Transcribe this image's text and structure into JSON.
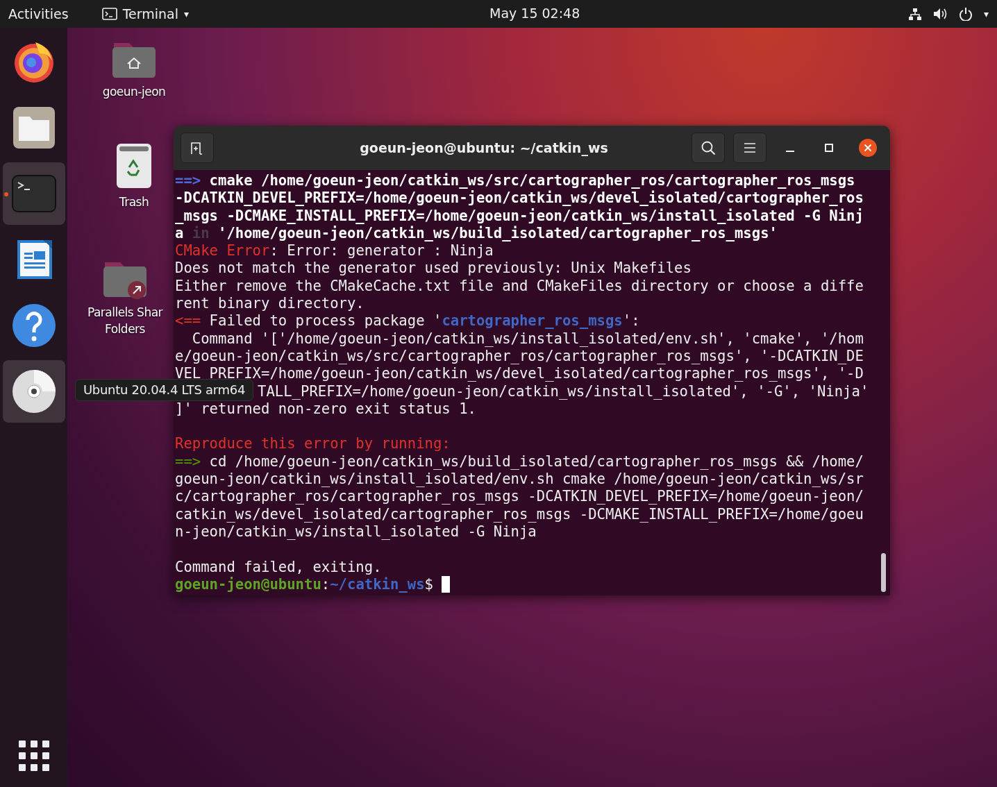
{
  "top_bar": {
    "activities": "Activities",
    "app_menu": {
      "label": "Terminal",
      "caret": "▾"
    },
    "clock": "May 15  02:48",
    "status_caret": "▾"
  },
  "dock": {
    "items": [
      {
        "kind": "browser",
        "running": false,
        "highlighted": false
      },
      {
        "kind": "files",
        "running": false,
        "highlighted": false
      },
      {
        "kind": "terminal",
        "running": true,
        "highlighted": true
      },
      {
        "kind": "writer",
        "running": false,
        "highlighted": false
      },
      {
        "kind": "help",
        "running": false,
        "highlighted": false
      },
      {
        "kind": "disc",
        "running": false,
        "highlighted": true
      }
    ]
  },
  "tooltip": "Ubuntu 20.04.4 LTS arm64",
  "desktop_icons": [
    {
      "kind": "home",
      "label_lines": [
        "goeun-jeon"
      ]
    },
    {
      "kind": "trash",
      "label_lines": [
        "Trash"
      ]
    },
    {
      "kind": "shared",
      "label_lines": [
        "Parallels Shar",
        "Folders"
      ]
    }
  ],
  "terminal": {
    "title": "goeun-jeon@ubuntu: ~/catkin_ws",
    "lines": [
      {
        "kind": "text",
        "segments": [
          {
            "kind": "start_marker",
            "text": "==>"
          },
          {
            "kind": "command",
            "text": " cmake /home/goeun-jeon/catkin_ws/src/cartographer_ros/cartographer_ros_msgs"
          }
        ]
      },
      {
        "kind": "text",
        "segments": [
          {
            "kind": "command",
            "text": "-DCATKIN_DEVEL_PREFIX=/home/goeun-jeon/catkin_ws/devel_isolated/cartographer_ros"
          }
        ]
      },
      {
        "kind": "text",
        "segments": [
          {
            "kind": "command",
            "text": "_msgs -DCMAKE_INSTALL_PREFIX=/home/goeun-jeon/catkin_ws/install_isolated -G Ninj"
          }
        ]
      },
      {
        "kind": "text",
        "segments": [
          {
            "kind": "command",
            "text": "a "
          },
          {
            "kind": "faint_word",
            "text": "in"
          },
          {
            "kind": "command",
            "text": " '/home/goeun-jeon/catkin_ws/build_isolated/cartographer_ros_msgs'"
          }
        ]
      },
      {
        "kind": "text",
        "segments": [
          {
            "kind": "error_label",
            "text": "CMake Error"
          },
          {
            "kind": "output",
            "text": ": Error: generator : Ninja"
          }
        ]
      },
      {
        "kind": "text",
        "segments": [
          {
            "kind": "output",
            "text": "Does not match the generator used previously: Unix Makefiles"
          }
        ]
      },
      {
        "kind": "text",
        "segments": [
          {
            "kind": "output",
            "text": "Either remove the CMakeCache.txt file and CMakeFiles directory or choose a diffe"
          }
        ]
      },
      {
        "kind": "text",
        "segments": [
          {
            "kind": "output",
            "text": "rent binary directory."
          }
        ]
      },
      {
        "kind": "text",
        "segments": [
          {
            "kind": "failure_marker",
            "text": "<=="
          },
          {
            "kind": "output",
            "text": " Failed to process package '"
          },
          {
            "kind": "package_name",
            "text": "cartographer_ros_msgs"
          },
          {
            "kind": "output",
            "text": "':"
          }
        ]
      },
      {
        "kind": "text",
        "segments": [
          {
            "kind": "output",
            "text": "  Command '['/home/goeun-jeon/catkin_ws/install_isolated/env.sh', 'cmake', '/hom"
          }
        ]
      },
      {
        "kind": "text",
        "segments": [
          {
            "kind": "output",
            "text": "e/goeun-jeon/catkin_ws/src/cartographer_ros/cartographer_ros_msgs', '-DCATKIN_DE"
          }
        ]
      },
      {
        "kind": "text",
        "segments": [
          {
            "kind": "output",
            "text": "VEL_PREFIX=/home/goeun-jeon/catkin_ws/devel_isolated/cartographer_ros_msgs', '-D"
          }
        ]
      },
      {
        "kind": "covered",
        "segments": [
          {
            "kind": "output",
            "text": "TALL_PREFIX=/home/goeun-jeon/catkin_ws/install_isolated', '-G', 'Ninja'"
          }
        ]
      },
      {
        "kind": "text",
        "segments": [
          {
            "kind": "output",
            "text": "]' returned non-zero exit status 1."
          }
        ]
      },
      {
        "kind": "blank"
      },
      {
        "kind": "text",
        "segments": [
          {
            "kind": "error_label",
            "text": "Reproduce this error by running:"
          }
        ]
      },
      {
        "kind": "text",
        "segments": [
          {
            "kind": "reproduce_marker",
            "text": "==>"
          },
          {
            "kind": "output",
            "text": " cd /home/goeun-jeon/catkin_ws/build_isolated/cartographer_ros_msgs && /home/"
          }
        ]
      },
      {
        "kind": "text",
        "segments": [
          {
            "kind": "output",
            "text": "goeun-jeon/catkin_ws/install_isolated/env.sh cmake /home/goeun-jeon/catkin_ws/sr"
          }
        ]
      },
      {
        "kind": "text",
        "segments": [
          {
            "kind": "output",
            "text": "c/cartographer_ros/cartographer_ros_msgs -DCATKIN_DEVEL_PREFIX=/home/goeun-jeon/"
          }
        ]
      },
      {
        "kind": "text",
        "segments": [
          {
            "kind": "output",
            "text": "catkin_ws/devel_isolated/cartographer_ros_msgs -DCMAKE_INSTALL_PREFIX=/home/goeu"
          }
        ]
      },
      {
        "kind": "text",
        "segments": [
          {
            "kind": "output",
            "text": "n-jeon/catkin_ws/install_isolated -G Ninja"
          }
        ]
      },
      {
        "kind": "blank"
      },
      {
        "kind": "text",
        "segments": [
          {
            "kind": "output",
            "text": "Command failed, exiting."
          }
        ]
      },
      {
        "kind": "prompt",
        "cursor": true,
        "segments": [
          {
            "kind": "prompt_user",
            "text": "goeun-jeon@ubuntu"
          },
          {
            "kind": "output",
            "text": ":"
          },
          {
            "kind": "prompt_path",
            "text": "~/catkin_ws"
          },
          {
            "kind": "output",
            "text": "$"
          }
        ]
      }
    ]
  }
}
